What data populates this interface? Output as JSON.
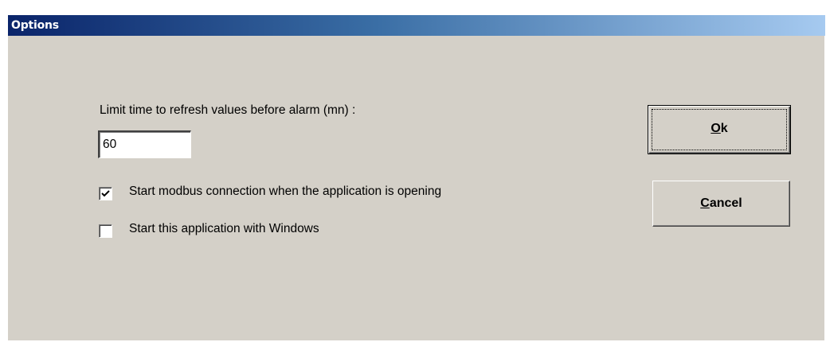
{
  "window": {
    "title": "Options"
  },
  "options": {
    "limit_label": "Limit time to refresh values before alarm (mn) :",
    "limit_value": "60",
    "checkbox_modbus": {
      "label": "Start modbus connection when the application is opening",
      "checked": true
    },
    "checkbox_windows": {
      "label": "Start this application with Windows",
      "checked": false
    }
  },
  "buttons": {
    "ok": {
      "mnemonic": "O",
      "rest": "k"
    },
    "cancel": {
      "mnemonic": "C",
      "rest": "ancel"
    }
  },
  "colors": {
    "dialog_bg": "#d4d0c8",
    "titlebar_start": "#0a246a",
    "titlebar_end": "#a6caf0"
  }
}
